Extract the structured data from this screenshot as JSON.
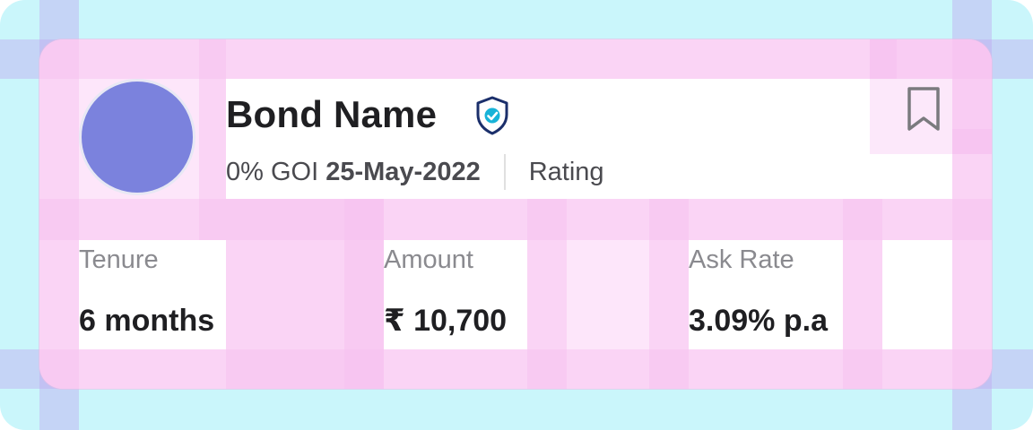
{
  "bond": {
    "name": "Bond Name",
    "description_prefix": "0% GOI ",
    "description_date": "25-May-2022",
    "rating_label": "Rating"
  },
  "icons": {
    "verified": "verified-shield-icon",
    "bookmark": "bookmark-icon"
  },
  "stats": [
    {
      "label": "Tenure",
      "value": "6 months"
    },
    {
      "label": "Amount",
      "value": "₹ 10,700"
    },
    {
      "label": "Ask Rate",
      "value": "3.09% p.a"
    }
  ],
  "colors": {
    "avatar": "#7b82dd",
    "shield_outline": "#1b2f6b",
    "shield_check": "#18b3d8",
    "frame_background": "#caf6fb",
    "card_background": "#fde6fa"
  }
}
